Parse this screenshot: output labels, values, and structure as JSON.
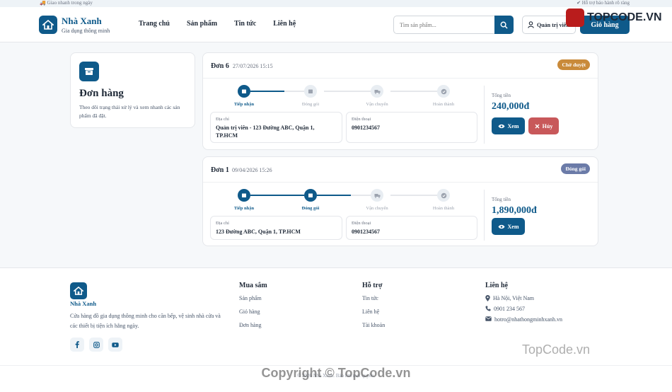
{
  "topstrip": {
    "left": "Giao nhanh trong ngày",
    "right": "Hỗ trợ bảo hành rõ ràng"
  },
  "header": {
    "brand": "Nhà Xanh",
    "tagline": "Gia dụng thông minh",
    "nav": [
      "Trang chủ",
      "Sản phẩm",
      "Tin tức",
      "Liên hệ"
    ],
    "search_placeholder": "Tìm sản phẩm...",
    "user_label": "Quản trị viên",
    "cart_label": "Giỏ hàng"
  },
  "intro": {
    "title": "Đơn hàng",
    "description": "Theo dõi trạng thái xử lý và xem nhanh các sản phẩm đã đặt."
  },
  "steps": [
    "Tiếp nhận",
    "Đóng gói",
    "Vận chuyển",
    "Hoàn thành"
  ],
  "orders": [
    {
      "code": "Đơn 6",
      "date": "27/07/2026 15:15",
      "status": "Chờ duyệt",
      "status_color": "#c98a3a",
      "progress_step": 1,
      "address_label": "Địa chỉ",
      "address": "Quản trị viên - 123 Đường ABC, Quận 1, TP.HCM",
      "phone_label": "Điện thoại",
      "phone": "0901234567",
      "total_label": "Tổng tiền",
      "total": "240,000đ",
      "view_label": "Xem",
      "cancel_label": "Hủy"
    },
    {
      "code": "Đơn 1",
      "date": "09/04/2026 15:26",
      "status": "Đóng gói",
      "status_color": "#6b7ba8",
      "progress_step": 2,
      "address_label": "Địa chỉ",
      "address": "123 Đường ABC, Quận 1, TP.HCM",
      "phone_label": "Điện thoại",
      "phone": "0901234567",
      "total_label": "Tổng tiền",
      "total": "1,890,000đ",
      "view_label": "Xem"
    }
  ],
  "footer": {
    "brand": "Nhà Xanh",
    "description": "Cửa hàng đồ gia dụng thông minh cho căn bếp, vệ sinh nhà cửa và các thiết bị tiện ích hằng ngày.",
    "shop_title": "Mua sắm",
    "shop_links": [
      "Sản phẩm",
      "Giỏ hàng",
      "Đơn hàng"
    ],
    "support_title": "Hỗ trợ",
    "support_links": [
      "Tin tức",
      "Liên hệ",
      "Tài khoản"
    ],
    "contact_title": "Liên hệ",
    "contact_address": "Hà Nội, Việt Nam",
    "contact_phone": "0901 234 567",
    "contact_email": "hotro@nhathongminhxanh.vn",
    "copyright": "© 2026 Nhà Xanh. Bảo lưu mọi quyền."
  },
  "watermark": {
    "logo_text": "TOPCODE.VN",
    "center": "Copyright © TopCode.vn",
    "right": "TopCode.vn"
  },
  "colors": {
    "primary": "#0f5a8a",
    "danger": "#c8585a"
  },
  "icons": {
    "truck": "truck-icon",
    "search": "search-icon",
    "user": "user-icon",
    "cart": "cart-icon",
    "box": "box-icon",
    "eye": "eye-icon",
    "close": "close-icon",
    "check": "check-icon",
    "facebook": "facebook-icon",
    "instagram": "instagram-icon",
    "youtube": "youtube-icon",
    "pin": "map-pin-icon",
    "phone": "phone-icon",
    "mail": "mail-icon"
  }
}
